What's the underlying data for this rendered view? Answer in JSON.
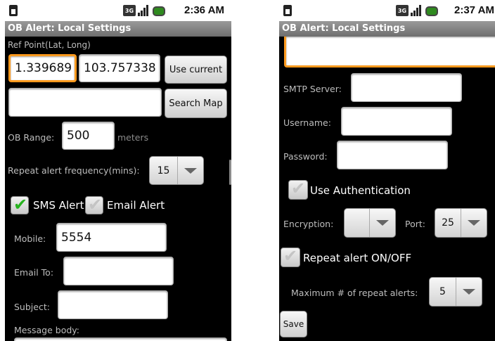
{
  "left": {
    "time": "2:36 AM",
    "title": "OB Alert: Local Settings",
    "ref_point_label": "Ref Point(Lat, Long)",
    "lat_value": "1.339689",
    "long_value": "103.757338",
    "use_current_label": "Use current",
    "search_value": "",
    "search_map_label": "Search Map",
    "ob_range_label": "OB Range:",
    "ob_range_value": "500",
    "meters_label": "meters",
    "repeat_freq_label": "Repeat alert frequency(mins):",
    "repeat_freq_value": "15",
    "sms_alert_label": "SMS Alert",
    "sms_alert_checked": true,
    "email_alert_label": "Email Alert",
    "email_alert_checked": false,
    "mobile_label": "Mobile:",
    "mobile_value": "5554",
    "email_to_label": "Email To:",
    "email_to_value": "",
    "subject_label": "Subject:",
    "subject_value": "",
    "message_body_label": "Message body:"
  },
  "right": {
    "time": "2:37 AM",
    "title": "OB Alert: Local Settings",
    "smtp_label": "SMTP Server:",
    "smtp_value": "",
    "username_label": "Username:",
    "username_value": "",
    "password_label": "Password:",
    "password_value": "",
    "use_auth_label": "Use Authentication",
    "use_auth_checked": false,
    "encryption_label": "Encryption:",
    "encryption_value": "",
    "port_label": "Port:",
    "port_value": "25",
    "repeat_onoff_label": "Repeat alert ON/OFF",
    "repeat_onoff_checked": false,
    "max_repeat_label": "Maximum # of repeat alerts:",
    "max_repeat_value": "5",
    "save_label": "Save"
  },
  "colors": {
    "focus_border": "#ff9a1e",
    "check_on": "#27b31f",
    "battery": "#2f8a1f"
  }
}
